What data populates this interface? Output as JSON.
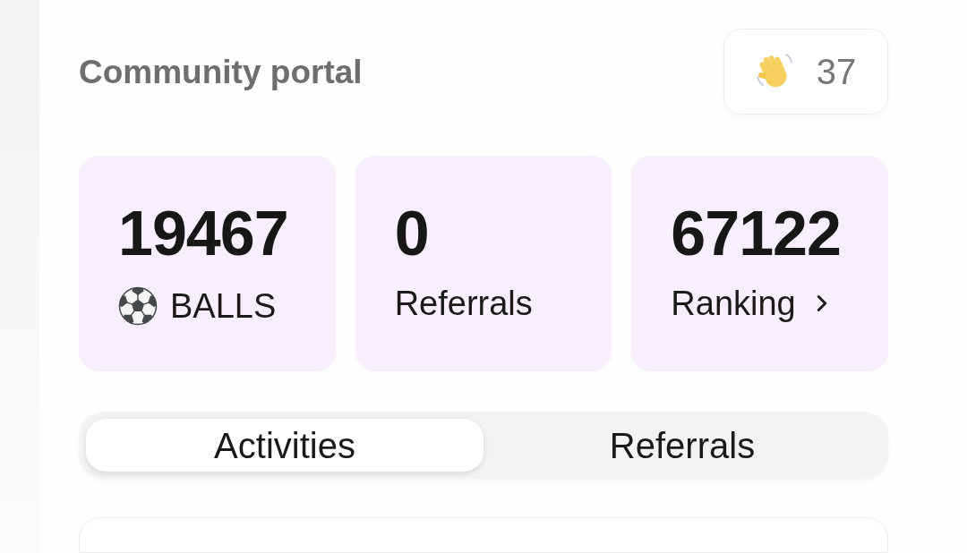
{
  "header": {
    "title": "Community portal",
    "wave_badge": {
      "count": "37"
    }
  },
  "stats": [
    {
      "kind": "balls",
      "value": "19467",
      "label": "BALLS"
    },
    {
      "kind": "plain",
      "value": "0",
      "label": "Referrals"
    },
    {
      "kind": "link",
      "value": "67122",
      "label": "Ranking"
    }
  ],
  "tabs": [
    {
      "label": "Activities",
      "selected": true
    },
    {
      "label": "Referrals",
      "selected": false
    }
  ]
}
